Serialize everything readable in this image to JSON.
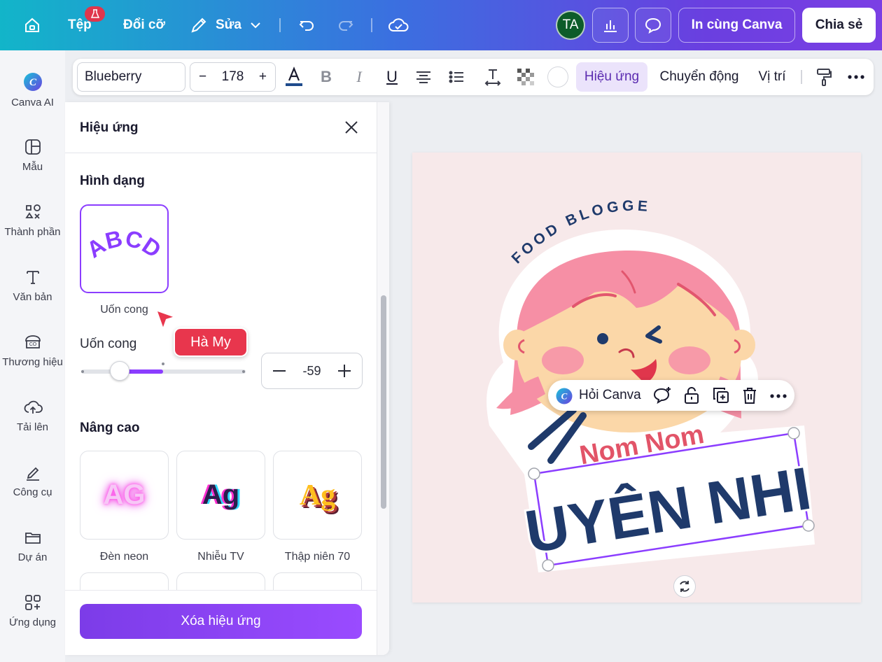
{
  "topbar": {
    "file_label": "Tệp",
    "resize_label": "Đổi cỡ",
    "edit_label": "Sửa",
    "avatar_initials": "TA",
    "print_label": "In cùng Canva",
    "share_label": "Chia sẻ"
  },
  "sidebar": {
    "items": [
      {
        "label": "Canva AI"
      },
      {
        "label": "Mẫu"
      },
      {
        "label": "Thành phần"
      },
      {
        "label": "Văn bản"
      },
      {
        "label": "Thương hiệu"
      },
      {
        "label": "Tải lên"
      },
      {
        "label": "Công cụ"
      },
      {
        "label": "Dự án"
      },
      {
        "label": "Ứng dụng"
      }
    ]
  },
  "toolbar": {
    "font_name": "Blueberry",
    "font_size": "178",
    "effects_label": "Hiệu ứng",
    "animate_label": "Chuyển động",
    "position_label": "Vị trí"
  },
  "panel": {
    "title": "Hiệu ứng",
    "shape_heading": "Hình dạng",
    "curve_preview_text": "ABCD",
    "curve_card_label": "Uốn cong",
    "curve_slider_label": "Uốn cong",
    "curve_value": "-59",
    "advanced_heading": "Nâng cao",
    "effects": [
      {
        "preview": "AG",
        "label": "Đèn neon"
      },
      {
        "preview": "Ag",
        "label": "Nhiễu TV"
      },
      {
        "preview": "Ag",
        "label": "Thập niên 70"
      }
    ],
    "remove_label": "Xóa hiệu ứng"
  },
  "cursor": {
    "collaborator_name": "Hà My"
  },
  "design": {
    "top_text": "FOOD BLOGGER",
    "subtitle": "Nom Nom",
    "name": "UYÊN NHI"
  },
  "context_bar": {
    "ask_label": "Hỏi Canva"
  }
}
